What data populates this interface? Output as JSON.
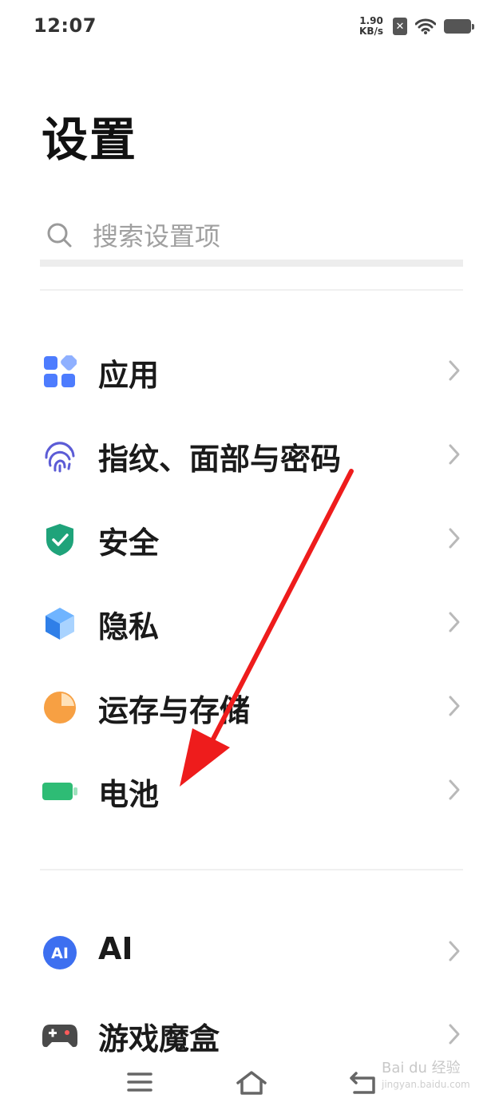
{
  "status_bar": {
    "time": "12:07",
    "net_speed_value": "1.90",
    "net_speed_unit": "KB/s"
  },
  "page_title": "设置",
  "search": {
    "placeholder": "搜索设置项"
  },
  "menu": [
    {
      "id": "apps",
      "label": "应用",
      "icon": "apps-grid-icon"
    },
    {
      "id": "fingerprint",
      "label": "指纹、面部与密码",
      "icon": "fingerprint-icon"
    },
    {
      "id": "security",
      "label": "安全",
      "icon": "shield-check-icon"
    },
    {
      "id": "privacy",
      "label": "隐私",
      "icon": "privacy-cube-icon"
    },
    {
      "id": "storage",
      "label": "运存与存储",
      "icon": "pie-chart-icon"
    },
    {
      "id": "battery",
      "label": "电池",
      "icon": "battery-icon"
    },
    {
      "id": "ai",
      "label": "AI",
      "icon": "ai-badge-icon",
      "icon_text": "AI"
    },
    {
      "id": "game",
      "label": "游戏魔盒",
      "icon": "gamepad-icon"
    }
  ],
  "colors": {
    "apps": "#4d7cfe",
    "fingerprint": "#5c5cd6",
    "security": "#1fa37a",
    "privacy": "#3a8bf0",
    "storage": "#f7a043",
    "battery": "#2ebc75",
    "ai": "#3d6ff0",
    "annotation_arrow": "#ee1c1c"
  },
  "watermark": {
    "text": "Bai du 经验",
    "sub": "jingyan.baidu.com"
  }
}
